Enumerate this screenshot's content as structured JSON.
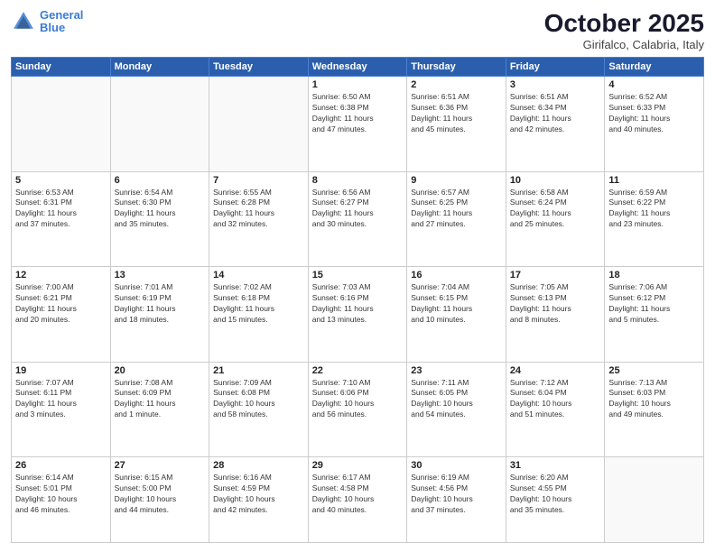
{
  "header": {
    "logo_line1": "General",
    "logo_line2": "Blue",
    "month": "October 2025",
    "location": "Girifalco, Calabria, Italy"
  },
  "days_of_week": [
    "Sunday",
    "Monday",
    "Tuesday",
    "Wednesday",
    "Thursday",
    "Friday",
    "Saturday"
  ],
  "weeks": [
    [
      {
        "day": "",
        "info": ""
      },
      {
        "day": "",
        "info": ""
      },
      {
        "day": "",
        "info": ""
      },
      {
        "day": "1",
        "info": "Sunrise: 6:50 AM\nSunset: 6:38 PM\nDaylight: 11 hours\nand 47 minutes."
      },
      {
        "day": "2",
        "info": "Sunrise: 6:51 AM\nSunset: 6:36 PM\nDaylight: 11 hours\nand 45 minutes."
      },
      {
        "day": "3",
        "info": "Sunrise: 6:51 AM\nSunset: 6:34 PM\nDaylight: 11 hours\nand 42 minutes."
      },
      {
        "day": "4",
        "info": "Sunrise: 6:52 AM\nSunset: 6:33 PM\nDaylight: 11 hours\nand 40 minutes."
      }
    ],
    [
      {
        "day": "5",
        "info": "Sunrise: 6:53 AM\nSunset: 6:31 PM\nDaylight: 11 hours\nand 37 minutes."
      },
      {
        "day": "6",
        "info": "Sunrise: 6:54 AM\nSunset: 6:30 PM\nDaylight: 11 hours\nand 35 minutes."
      },
      {
        "day": "7",
        "info": "Sunrise: 6:55 AM\nSunset: 6:28 PM\nDaylight: 11 hours\nand 32 minutes."
      },
      {
        "day": "8",
        "info": "Sunrise: 6:56 AM\nSunset: 6:27 PM\nDaylight: 11 hours\nand 30 minutes."
      },
      {
        "day": "9",
        "info": "Sunrise: 6:57 AM\nSunset: 6:25 PM\nDaylight: 11 hours\nand 27 minutes."
      },
      {
        "day": "10",
        "info": "Sunrise: 6:58 AM\nSunset: 6:24 PM\nDaylight: 11 hours\nand 25 minutes."
      },
      {
        "day": "11",
        "info": "Sunrise: 6:59 AM\nSunset: 6:22 PM\nDaylight: 11 hours\nand 23 minutes."
      }
    ],
    [
      {
        "day": "12",
        "info": "Sunrise: 7:00 AM\nSunset: 6:21 PM\nDaylight: 11 hours\nand 20 minutes."
      },
      {
        "day": "13",
        "info": "Sunrise: 7:01 AM\nSunset: 6:19 PM\nDaylight: 11 hours\nand 18 minutes."
      },
      {
        "day": "14",
        "info": "Sunrise: 7:02 AM\nSunset: 6:18 PM\nDaylight: 11 hours\nand 15 minutes."
      },
      {
        "day": "15",
        "info": "Sunrise: 7:03 AM\nSunset: 6:16 PM\nDaylight: 11 hours\nand 13 minutes."
      },
      {
        "day": "16",
        "info": "Sunrise: 7:04 AM\nSunset: 6:15 PM\nDaylight: 11 hours\nand 10 minutes."
      },
      {
        "day": "17",
        "info": "Sunrise: 7:05 AM\nSunset: 6:13 PM\nDaylight: 11 hours\nand 8 minutes."
      },
      {
        "day": "18",
        "info": "Sunrise: 7:06 AM\nSunset: 6:12 PM\nDaylight: 11 hours\nand 5 minutes."
      }
    ],
    [
      {
        "day": "19",
        "info": "Sunrise: 7:07 AM\nSunset: 6:11 PM\nDaylight: 11 hours\nand 3 minutes."
      },
      {
        "day": "20",
        "info": "Sunrise: 7:08 AM\nSunset: 6:09 PM\nDaylight: 11 hours\nand 1 minute."
      },
      {
        "day": "21",
        "info": "Sunrise: 7:09 AM\nSunset: 6:08 PM\nDaylight: 10 hours\nand 58 minutes."
      },
      {
        "day": "22",
        "info": "Sunrise: 7:10 AM\nSunset: 6:06 PM\nDaylight: 10 hours\nand 56 minutes."
      },
      {
        "day": "23",
        "info": "Sunrise: 7:11 AM\nSunset: 6:05 PM\nDaylight: 10 hours\nand 54 minutes."
      },
      {
        "day": "24",
        "info": "Sunrise: 7:12 AM\nSunset: 6:04 PM\nDaylight: 10 hours\nand 51 minutes."
      },
      {
        "day": "25",
        "info": "Sunrise: 7:13 AM\nSunset: 6:03 PM\nDaylight: 10 hours\nand 49 minutes."
      }
    ],
    [
      {
        "day": "26",
        "info": "Sunrise: 6:14 AM\nSunset: 5:01 PM\nDaylight: 10 hours\nand 46 minutes."
      },
      {
        "day": "27",
        "info": "Sunrise: 6:15 AM\nSunset: 5:00 PM\nDaylight: 10 hours\nand 44 minutes."
      },
      {
        "day": "28",
        "info": "Sunrise: 6:16 AM\nSunset: 4:59 PM\nDaylight: 10 hours\nand 42 minutes."
      },
      {
        "day": "29",
        "info": "Sunrise: 6:17 AM\nSunset: 4:58 PM\nDaylight: 10 hours\nand 40 minutes."
      },
      {
        "day": "30",
        "info": "Sunrise: 6:19 AM\nSunset: 4:56 PM\nDaylight: 10 hours\nand 37 minutes."
      },
      {
        "day": "31",
        "info": "Sunrise: 6:20 AM\nSunset: 4:55 PM\nDaylight: 10 hours\nand 35 minutes."
      },
      {
        "day": "",
        "info": ""
      }
    ]
  ]
}
